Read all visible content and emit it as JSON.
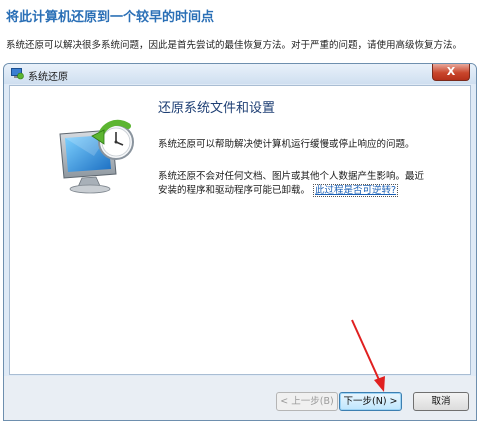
{
  "page": {
    "heading": "将此计算机还原到一个较早的时间点",
    "description": "系统还原可以解决很多系统问题，因此是首先尝试的最佳恢复方法。对于严重的问题，请使用高级恢复方法。"
  },
  "window": {
    "title": "系统还原",
    "close_label": "X"
  },
  "content": {
    "title": "还原系统文件和设置",
    "paragraph1": "系统还原可以帮助解决使计算机运行缓慢或停止响应的问题。",
    "paragraph2_line1": "系统还原不会对任何文档、图片或其他个人数据产生影响。最近",
    "paragraph2_line2": "安装的程序和驱动程序可能已卸载。",
    "link_text": "此过程是否可逆转?"
  },
  "buttons": {
    "back": "< 上一步(B)",
    "next": "下一步(N) >",
    "cancel": "取消"
  },
  "colors": {
    "heading": "#2a6fb6",
    "annotation_arrow": "#e02020",
    "restore_arrow": "#5cb531"
  },
  "icons": {
    "window_icon": "system-restore-icon",
    "illustration": "computer-restore-icon",
    "annotation": "red-pointer-arrow"
  }
}
